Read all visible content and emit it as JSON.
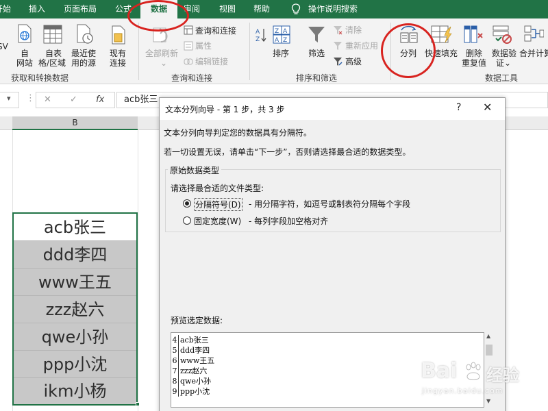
{
  "ribbon_tabs": {
    "start": "开始",
    "insert": "插入",
    "page_layout": "页面布局",
    "formulas": "公式",
    "data": "数据",
    "review": "审阅",
    "view": "视图",
    "help": "帮助",
    "tell_me": "操作说明搜索"
  },
  "ribbon": {
    "get_transform": {
      "sv_label": "SV",
      "from_web_line1": "自",
      "from_web_line2": "网站",
      "from_table_line1": "自表",
      "from_table_line2": "格/区域",
      "recent_line1": "最近使",
      "recent_line2": "用的源",
      "existing_line1": "现有",
      "existing_line2": "连接",
      "group_label": "获取和转换数据"
    },
    "queries": {
      "refresh_all": "全部刷新",
      "queries_connections": "查询和连接",
      "properties": "属性",
      "edit_links": "编辑链接",
      "group_label": "查询和连接"
    },
    "sort_filter": {
      "sort": "排序",
      "filter": "筛选",
      "clear": "清除",
      "reapply": "重新应用",
      "advanced": "高级",
      "group_label": "排序和筛选"
    },
    "data_tools": {
      "text_to_columns": "分列",
      "flash_fill": "快速填充",
      "remove_dup_line1": "删除",
      "remove_dup_line2": "重复值",
      "validation_line1": "数据验",
      "validation_line2": "证",
      "consolidate": "合并计算",
      "group_label": "数据工具"
    }
  },
  "formula_bar": {
    "fx": "fx",
    "value": "acb张三"
  },
  "sheet": {
    "column_b": "B",
    "column_right_fragment": "]",
    "cells": [
      "acb张三",
      "ddd李四",
      "www王五",
      "zzz赵六",
      "qwe小孙",
      "ppp小沈",
      "ikm小杨"
    ]
  },
  "dialog": {
    "title": "文本分列向导 - 第 1 步，共 3 步",
    "help": "?",
    "close": "✕",
    "intro": "文本分列向导判定您的数据具有分隔符。",
    "instruction": "若一切设置无误，请单击“下一步”，否则请选择最合适的数据类型。",
    "group_title": "原始数据类型",
    "choose_type": "请选择最合适的文件类型:",
    "delimited_label": "分隔符号(D)",
    "delimited_desc": "- 用分隔字符，如逗号或制表符分隔每个字段",
    "fixed_label": "固定宽度(W)",
    "fixed_desc": "- 每列字段加空格对齐",
    "preview_label": "预览选定数据:",
    "preview_rows": [
      {
        "num": "4",
        "text": "acb张三"
      },
      {
        "num": "5",
        "text": "ddd李四"
      },
      {
        "num": "6",
        "text": "www王五"
      },
      {
        "num": "7",
        "text": "zzz赵六"
      },
      {
        "num": "8",
        "text": "qwe小孙"
      },
      {
        "num": "9",
        "text": "ppp小沈"
      }
    ]
  },
  "watermark": {
    "brand": "Bai",
    "brand_cn": "经验",
    "url": "jingyan.baidu.com"
  },
  "colors": {
    "excel_green": "#217346",
    "annotation_red": "#d8231f",
    "selection_gray": "#c8c8c8"
  },
  "icons": [
    "lightbulb-icon",
    "web-icon",
    "table-icon",
    "recent-sources-icon",
    "existing-connections-icon",
    "refresh-icon",
    "sort-az-icon",
    "sort-icon",
    "filter-icon",
    "text-to-columns-icon",
    "flash-fill-icon",
    "remove-duplicates-icon",
    "data-validation-icon",
    "consolidate-icon"
  ]
}
